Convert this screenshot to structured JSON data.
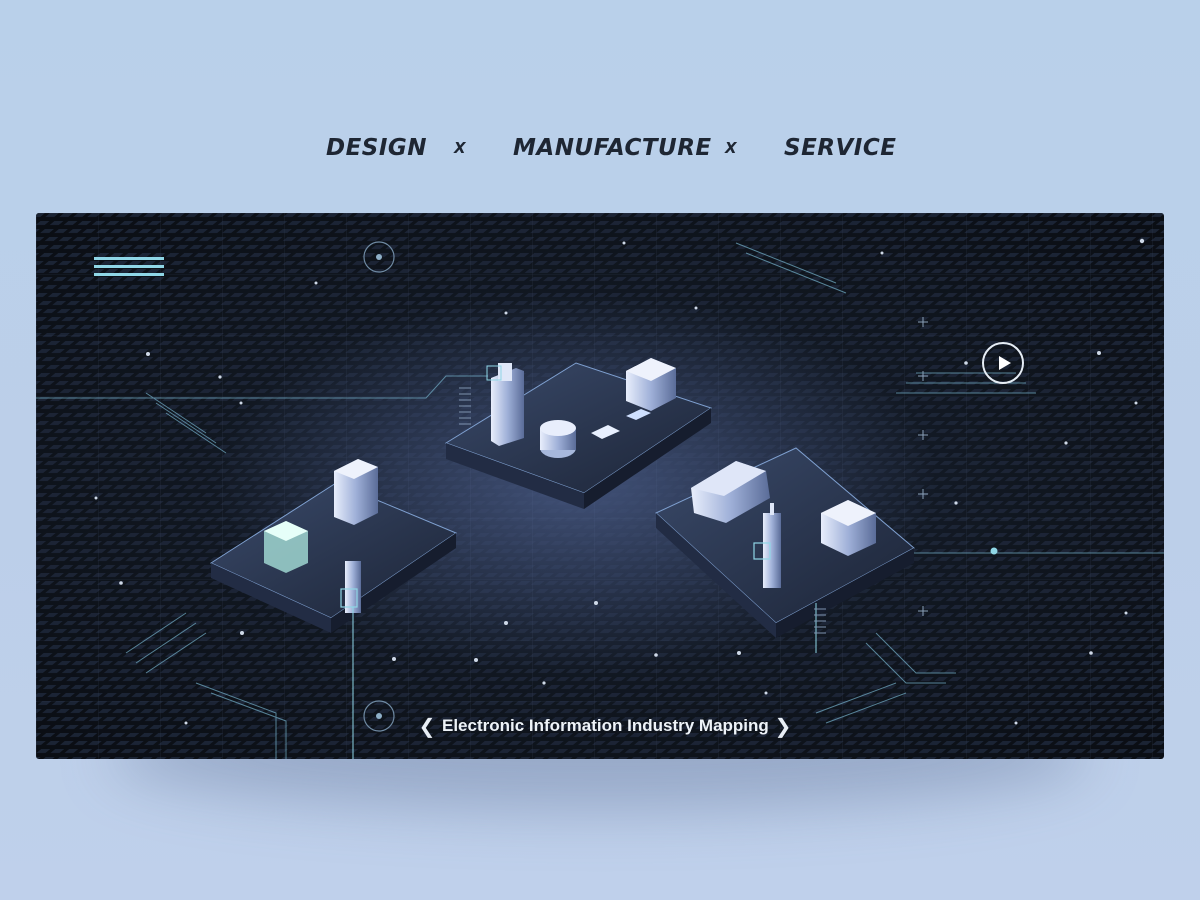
{
  "tagline": {
    "item1": "DESIGN",
    "sep1": "X",
    "item2": "MANUFACTURE",
    "sep2": "X",
    "item3": "SERVICE"
  },
  "hero": {
    "caption": "Electronic Information Industry Mapping",
    "prev_icon": "chevron-left-icon",
    "next_icon": "chevron-right-icon",
    "menu_icon": "hamburger-menu-icon",
    "play_icon": "play-icon",
    "target_icon": "crosshair-target-icon",
    "accent_color": "#8fd6e6",
    "background_color": "#10161f"
  }
}
